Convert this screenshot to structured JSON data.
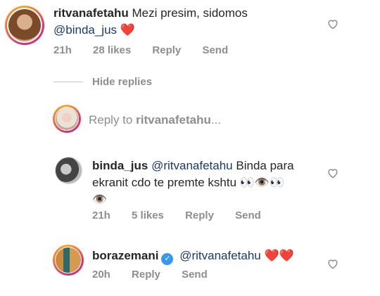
{
  "comments": [
    {
      "username": "ritvanafetahu",
      "text_before": "Mezi presim, sidomos",
      "mention": "@binda_jus",
      "emoji": "❤️",
      "time": "21h",
      "likes": "28 likes",
      "reply": "Reply",
      "send": "Send"
    }
  ],
  "hide_replies": "Hide replies",
  "reply_input": {
    "prefix": "Reply to",
    "target": "ritvanafetahu",
    "suffix": "..."
  },
  "replies": [
    {
      "username": "binda_jus",
      "mention": "@ritvanafetahu",
      "text_line1": "Binda para",
      "text_line2": "ekranit cdo te premte kshtu 👀👁️👀",
      "text_line3": "👁️",
      "time": "21h",
      "likes": "5 likes",
      "reply": "Reply",
      "send": "Send"
    },
    {
      "username": "borazemani",
      "verified": true,
      "mention": "@ritvanafetahu",
      "emoji": "❤️❤️",
      "time": "20h",
      "reply": "Reply",
      "send": "Send"
    }
  ],
  "colors": {
    "mention": "#1a3a6e",
    "meta": "#8e8e8e",
    "verified": "#3897f0"
  }
}
